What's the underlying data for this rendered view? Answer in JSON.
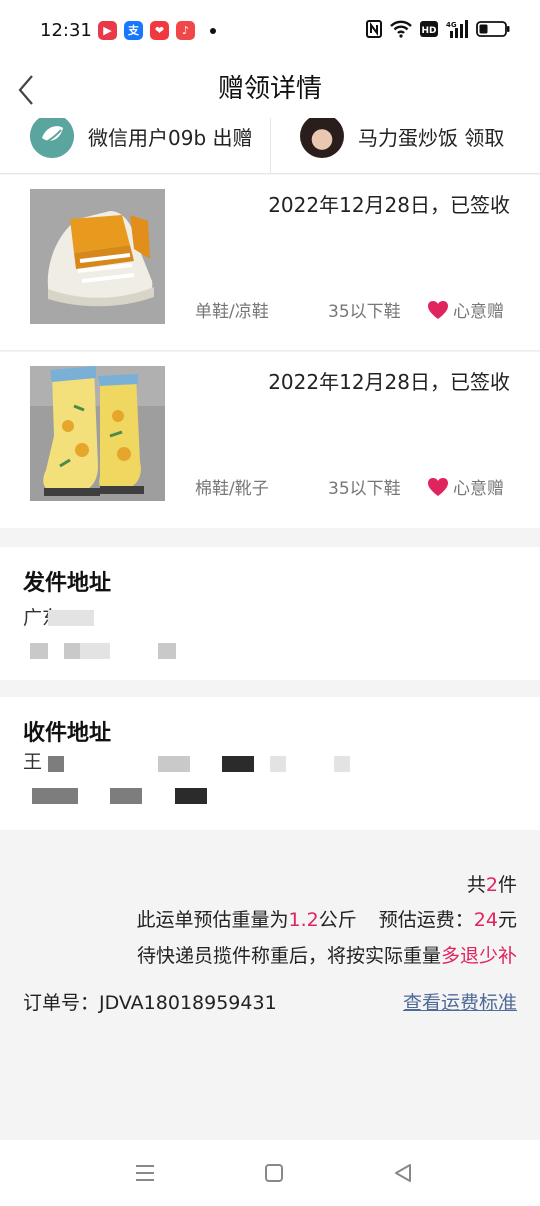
{
  "status_bar": {
    "time": "12:31",
    "icons": [
      "youtube-like-app-icon",
      "alipay-icon",
      "heart-app-icon",
      "music-app-icon",
      "nfc-icon",
      "wifi-icon",
      "hd-icon",
      "signal-4g-icon",
      "battery-icon"
    ]
  },
  "header": {
    "title": "赠领详情"
  },
  "users": {
    "giver": "微信用户09b 出赠",
    "receiver": "马力蛋炒饭 领取"
  },
  "items": [
    {
      "date": "2022年12月28日，已签收",
      "category": "单鞋/凉鞋",
      "size": "35以下鞋",
      "gift_type": "心意赠"
    },
    {
      "date": "2022年12月28日，已签收",
      "category": "棉鞋/靴子",
      "size": "35以下鞋",
      "gift_type": "心意赠"
    }
  ],
  "sender_address": {
    "title": "发件地址",
    "line1": "广东 "
  },
  "receiver_address": {
    "title": "收件地址",
    "line1": "王"
  },
  "summary": {
    "count_prefix": "共",
    "count": "2",
    "count_suffix": "件",
    "weight_prefix": "此运单预估重量为",
    "weight": "1.2",
    "weight_unit": "公斤",
    "fee_prefix": "预估运费：",
    "fee": "24",
    "fee_unit": "元",
    "note_prefix": "待快递员揽件称重后，将按实际重量",
    "note_highlight": "多退少补",
    "order_label": "订单号：JDVA18018959431",
    "fee_link": "查看运费标准"
  },
  "colors": {
    "accent": "#e0245e",
    "link": "#4f6b98",
    "heart": "#e0245e"
  },
  "nav": {
    "icons": [
      "menu-icon",
      "home-square-icon",
      "back-triangle-icon"
    ]
  }
}
